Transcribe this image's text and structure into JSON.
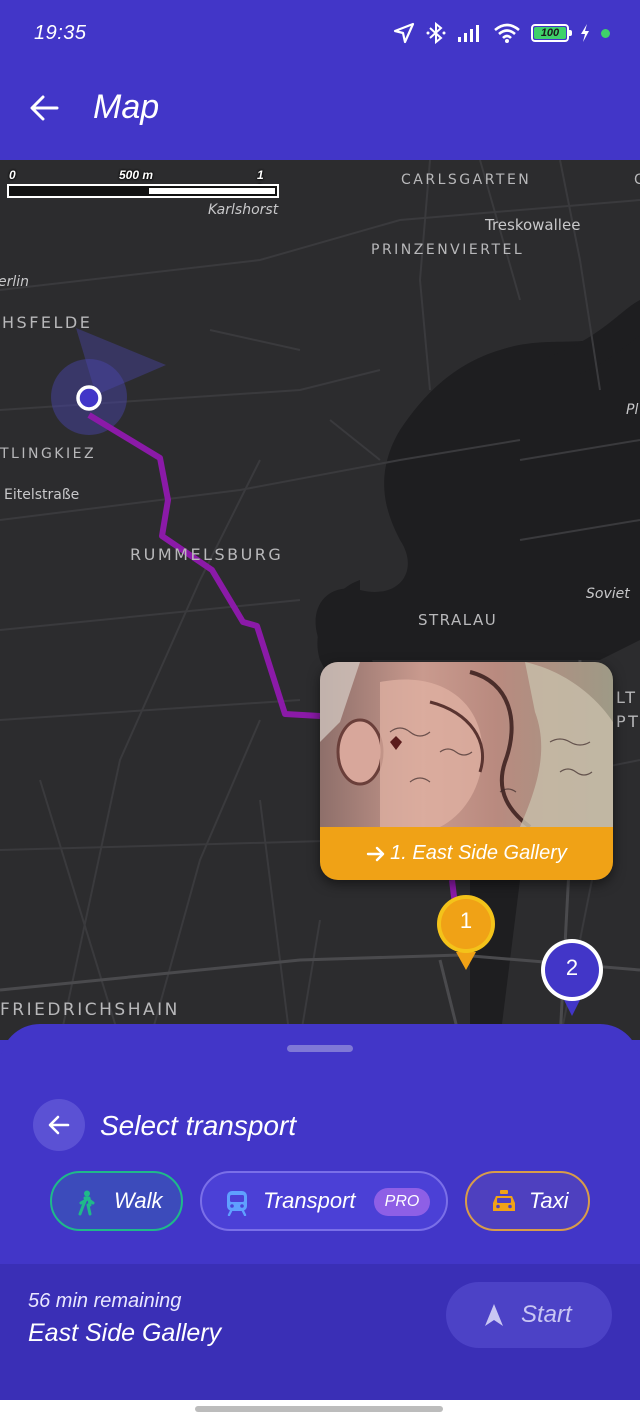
{
  "status_bar": {
    "time": "19:35",
    "battery": "100",
    "icons": [
      "location-arrow-icon",
      "bluetooth-icon",
      "signal-icon",
      "wifi-icon",
      "battery-icon",
      "charging-icon"
    ]
  },
  "app_bar": {
    "title": "Map",
    "back_icon": "arrow-left-icon"
  },
  "map": {
    "scale": {
      "zero": "0",
      "mid": "500 m",
      "end": "1 km"
    },
    "labels": {
      "karlshorst": "Karlshorst",
      "carlsgarten": "CARLSGARTEN",
      "treskowallee": "Treskowallee",
      "prinzenviertel": "PRINZENVIERTEL",
      "erlin": "erlin",
      "hsfelde": "HSFELDE",
      "tlingkiez": "TLINGKIEZ",
      "eitelstrasse": "Eitelstraße",
      "rummelsburg": "RUMMELSBURG",
      "stralau": "STRALAU",
      "soviet": "Soviet",
      "friedrichshain": "FRIEDRICHSHAIN",
      "lt": "LT",
      "pt": "PT",
      "pl": "Pl",
      "c": "C"
    },
    "poi_card": {
      "label": "1. East Side Gallery",
      "arrow_icon": "arrow-right-icon"
    },
    "markers": [
      {
        "number": "1",
        "color": "#f0a216"
      },
      {
        "number": "2",
        "color": "#4236c8"
      }
    ],
    "colors": {
      "route": "#8b1aa8",
      "background": "#2c2c2e",
      "river": "#1c1c1e"
    }
  },
  "sheet": {
    "title": "Select transport",
    "options": [
      {
        "label": "Walk",
        "icon": "walking-person-icon",
        "accent": "#1fb98a"
      },
      {
        "label": "Transport",
        "icon": "tram-icon",
        "badge": "PRO",
        "accent": "#7a6fe8"
      },
      {
        "label": "Taxi",
        "icon": "taxi-icon",
        "accent": "#f0a216"
      }
    ],
    "remaining": "56 min remaining",
    "destination": "East Side Gallery",
    "start_label": "Start",
    "start_icon": "navigation-arrow-icon"
  },
  "colors": {
    "primary": "#4236c8",
    "footer": "#3a2fb6"
  }
}
